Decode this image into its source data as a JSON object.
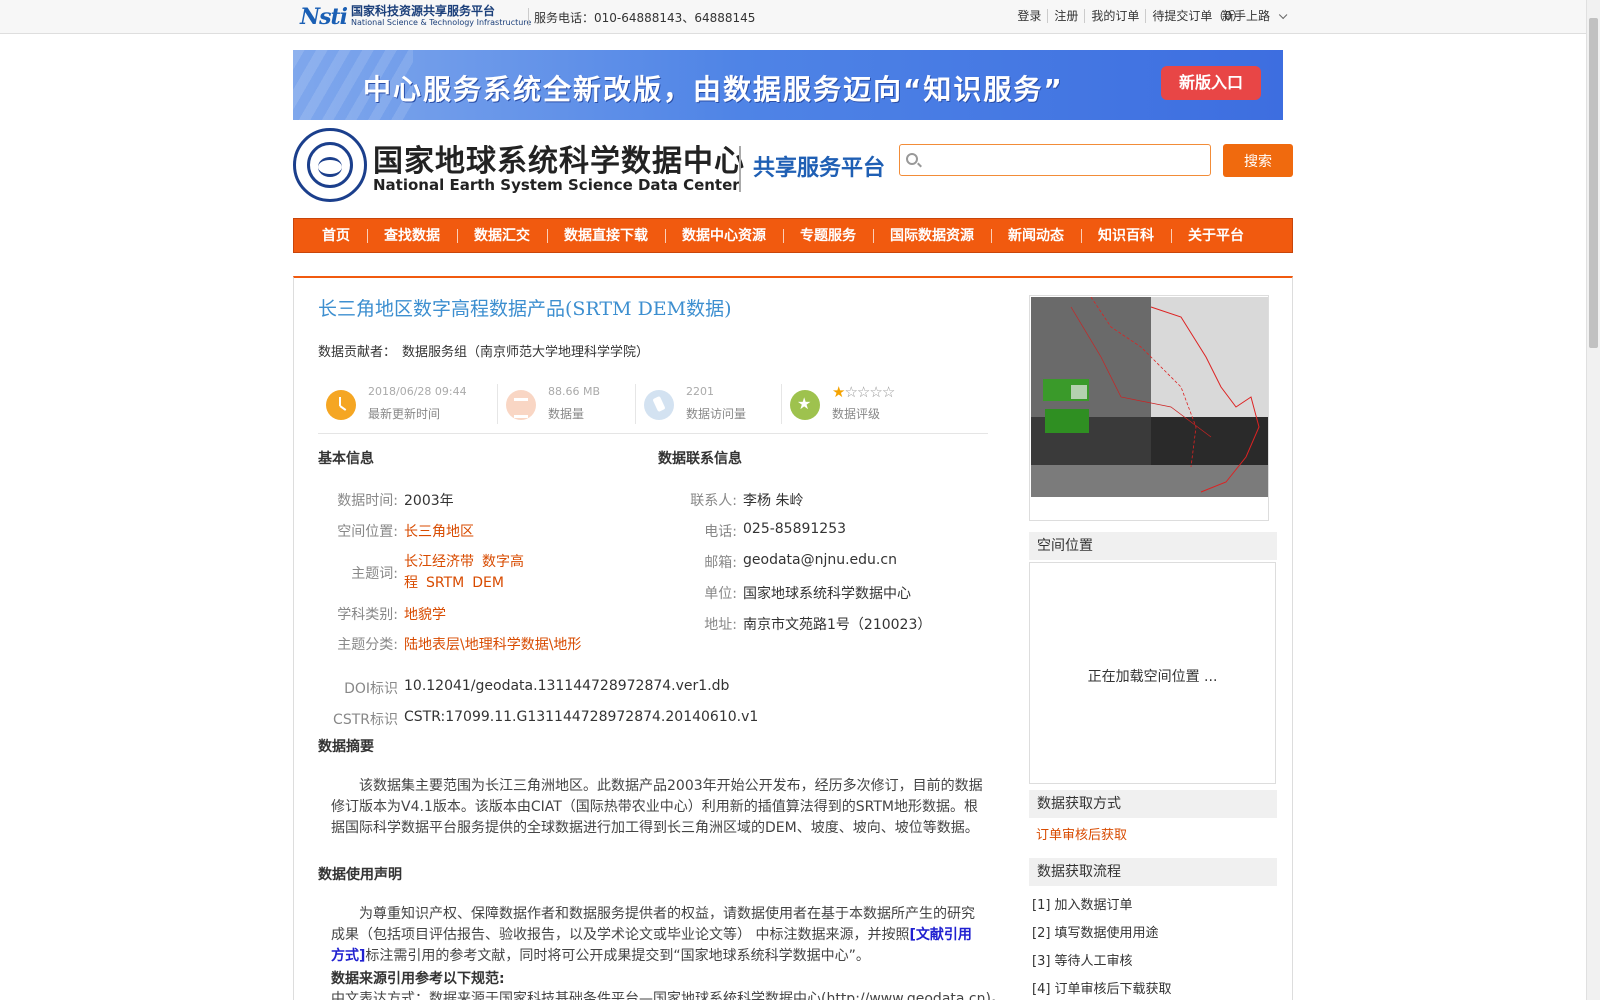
{
  "topbar": {
    "logo_mark": "Nsti",
    "logo_cn": "国家科技资源共享服务平台",
    "logo_en": "National Science & Technology Infrastructure",
    "hotline": "服务电话：010-64888143、64888145",
    "links": [
      "登录",
      "注册",
      "我的订单",
      "待提交订单（0）"
    ],
    "guide": "新手上路"
  },
  "banner": {
    "slogan": "中心服务系统全新改版，由数据服务迈向“知识服务”",
    "new_entry": "新版入口"
  },
  "header": {
    "site_cn": "国家地球系统科学数据中心",
    "site_en": "National Earth System Science Data Center",
    "platform": "共享服务平台",
    "search_placeholder": "",
    "search_button": "搜索"
  },
  "nav": [
    "首页",
    "查找数据",
    "数据汇交",
    "数据直接下载",
    "数据中心资源",
    "专题服务",
    "国际数据资源",
    "新闻动态",
    "知识百科",
    "关于平台"
  ],
  "dataset": {
    "title": "长三角地区数字高程数据产品(SRTM DEM数据)",
    "contributor_label": "数据贡献者：",
    "contributor": "数据服务组（南京师范大学地理科学学院）",
    "stats": {
      "updated": "2018/06/28 09:44",
      "updated_label": "最新更新时间",
      "size": "88.66 MB",
      "size_label": "数据量",
      "visits": "2201",
      "visits_label": "数据访问量",
      "rating_label": "数据评级",
      "rating_stars": 1,
      "rating_max": 5
    }
  },
  "basic": {
    "heading": "基本信息",
    "time_label": "数据时间:",
    "time": "2003年",
    "space_label": "空间位置:",
    "space": "长三角地区",
    "keywords_label": "主题词:",
    "keywords": [
      "长江经济带",
      "数字高程",
      "SRTM",
      "DEM"
    ],
    "discipline_label": "学科类别:",
    "discipline": "地貌学",
    "category_label": "主题分类:",
    "category": "陆地表层\\地理科学数据\\地形",
    "doi_label": "DOI标识",
    "doi": "10.12041/geodata.131144728972874.ver1.db",
    "cstr_label": "CSTR标识",
    "cstr": "CSTR:17099.11.G131144728972874.20140610.v1"
  },
  "contact": {
    "heading": "数据联系信息",
    "person_label": "联系人:",
    "person": "李杨 朱岭",
    "phone_label": "电话:",
    "phone": "025-85891253",
    "email_label": "邮箱:",
    "email": "geodata@njnu.edu.cn",
    "unit_label": "单位:",
    "unit": "国家地球系统科学数据中心",
    "address_label": "地址:",
    "address": "南京市文苑路1号（210023）"
  },
  "abstract": {
    "heading": "数据摘要",
    "text": "该数据集主要范围为长江三角洲地区。此数据产品2003年开始公开发布，经历多次修订，目前的数据修订版本为V4.1版本。该版本由CIAT（国际热带农业中心）利用新的插值算法得到的SRTM地形数据。根据国际科学数据平台服务提供的全球数据进行加工得到长三角洲区域的DEM、坡度、坡向、坡位等数据。"
  },
  "usage": {
    "heading": "数据使用声明",
    "text_before": "为尊重知识产权、保障数据作者和数据服务提供者的权益，请数据使用者在基于本数据所产生的研究成果（包括项目评估报告、验收报告，以及学术论文或毕业论文等） 中标注数据来源，并按照",
    "link": "[文献引用方式]",
    "text_after": "标注需引用的参考文献，同时将可公开成果提交到“国家地球系统科学数据中心”。",
    "rule_heading": "数据来源引用参考以下规范:",
    "rule_line": "中文表达方式：数据来源于国家科技基础条件平台—国家地球系统科学数据中心(http://www.geodata.cn)。"
  },
  "sidebar": {
    "location_heading": "空间位置",
    "location_loading": "正在加载空间位置 ...",
    "acquire_heading": "数据获取方式",
    "acquire_method": "订单审核后获取",
    "flow_heading": "数据获取流程",
    "flow_steps": [
      "[1] 加入数据订单",
      "[2] 填写数据使用用途",
      "[3] 等待人工审核",
      "[4] 订单审核后下载获取"
    ]
  },
  "colors": {
    "brand_orange": "#f15a0f",
    "title_blue": "#3d8fd0",
    "link_red": "#d84b00"
  }
}
